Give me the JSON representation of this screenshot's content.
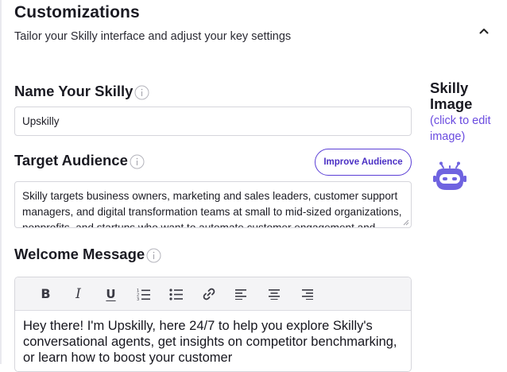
{
  "header": {
    "title": "Customizations",
    "subtitle": "Tailor your Skilly interface and adjust your key settings",
    "collapse_icon": "chevron-up-icon"
  },
  "name_section": {
    "label": "Name Your Skilly",
    "value": "Upskilly"
  },
  "audience_section": {
    "label": "Target Audience",
    "improve_button": "Improve Audience",
    "value": "Skilly targets business owners, marketing and sales leaders, customer support managers, and digital transformation teams at small to mid-sized organizations, nonprofits, and startups who want to automate customer engagement and sales."
  },
  "welcome_section": {
    "label": "Welcome Message",
    "toolbar": [
      "bold-icon",
      "italic-icon",
      "underline-icon",
      "ordered-list-icon",
      "bullet-list-icon",
      "link-icon",
      "align-left-icon",
      "align-center-icon",
      "align-right-icon"
    ],
    "value": "Hey there! I'm Upskilly, here 24/7 to help you explore Skilly's conversational agents, get insights on competitor benchmarking, or learn how to boost your customer"
  },
  "image_section": {
    "title": "Skilly Image",
    "link": "(click to edit image)",
    "avatar_icon": "robot-avatar-icon"
  },
  "colors": {
    "accent": "#5b3fd6",
    "avatar": "#6f63e0"
  }
}
